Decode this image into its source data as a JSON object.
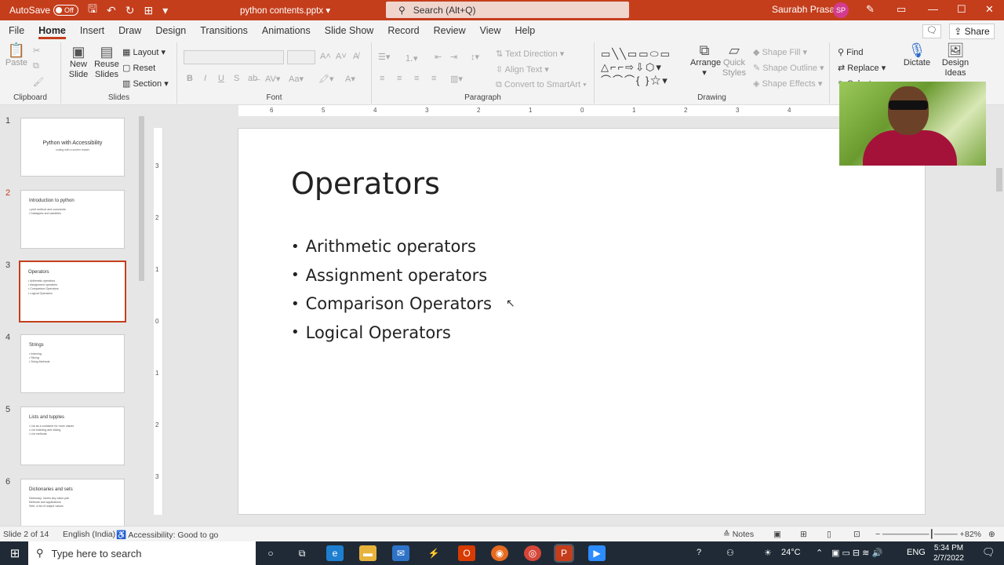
{
  "titlebar": {
    "autosave_label": "AutoSave",
    "autosave_state": "Off",
    "filename": "python contents.pptx",
    "search_placeholder": "Search (Alt+Q)",
    "user_name": "Saurabh Prasad",
    "user_initials": "SP"
  },
  "menu": {
    "tabs": [
      "File",
      "Home",
      "Insert",
      "Draw",
      "Design",
      "Transitions",
      "Animations",
      "Slide Show",
      "Record",
      "Review",
      "View",
      "Help"
    ],
    "active": "Home",
    "share_label": "Share"
  },
  "ribbon": {
    "clipboard": {
      "label": "Clipboard",
      "paste": "Paste"
    },
    "slides": {
      "label": "Slides",
      "new_slide": "New Slide",
      "reuse_slides": "Reuse Slides",
      "layout": "Layout",
      "reset": "Reset",
      "section": "Section"
    },
    "font": {
      "label": "Font"
    },
    "paragraph": {
      "label": "Paragraph",
      "text_direction": "Text Direction",
      "align_text": "Align Text",
      "convert_smartart": "Convert to SmartArt"
    },
    "drawing": {
      "label": "Drawing",
      "arrange": "Arrange",
      "quick_styles": "Quick Styles",
      "shape_fill": "Shape Fill",
      "shape_outline": "Shape Outline",
      "shape_effects": "Shape Effects"
    },
    "editing": {
      "find": "Find",
      "replace": "Replace",
      "select": "Select"
    },
    "voice": {
      "dictate": "Dictate"
    },
    "designer": {
      "design_ideas": "Design Ideas"
    }
  },
  "thumbnails": [
    {
      "num": "1",
      "title": "Python with Accessibility",
      "subtitle": "coding with a screen reader",
      "bullets": []
    },
    {
      "num": "2",
      "title": "Introduction to python",
      "bullets": [
        "print method and comments",
        "Datatypes and variables"
      ]
    },
    {
      "num": "3",
      "title": "Operators",
      "bullets": [
        "Arithmetic operators",
        "Assignment operators",
        "Comparison Operators",
        "Logical Operators"
      ]
    },
    {
      "num": "4",
      "title": "Strings",
      "bullets": [
        "Indexing",
        "Slicing",
        "String Methods"
      ]
    },
    {
      "num": "5",
      "title": "Lists and tupples",
      "bullets": [
        "List as a container for more values",
        "List indexing and slicing",
        "List methods"
      ]
    },
    {
      "num": "6",
      "title": "Dictionaries and sets",
      "bullets": [
        "Dictionary: stores key-value pair",
        "Methods and applications",
        "Sets: a list of unique values"
      ]
    }
  ],
  "ruler": {
    "h_ticks": [
      "6",
      "5",
      "4",
      "3",
      "2",
      "1",
      "0",
      "1",
      "2",
      "3",
      "4"
    ],
    "v_ticks": [
      "3",
      "2",
      "1",
      "0",
      "1",
      "2",
      "3"
    ]
  },
  "slide": {
    "title": "Operators",
    "bullets": [
      "Arithmetic operators",
      "Assignment operators",
      "Comparison Operators",
      "Logical Operators"
    ]
  },
  "status": {
    "slide_info": "Slide 2 of 14",
    "language": "English (India)",
    "accessibility": "Accessibility: Good to go",
    "notes": "Notes",
    "zoom": "82%"
  },
  "taskbar": {
    "search_placeholder": "Type here to search",
    "weather": "24°C",
    "lang": "ENG",
    "time": "5:34 PM",
    "date": "2/7/2022"
  }
}
